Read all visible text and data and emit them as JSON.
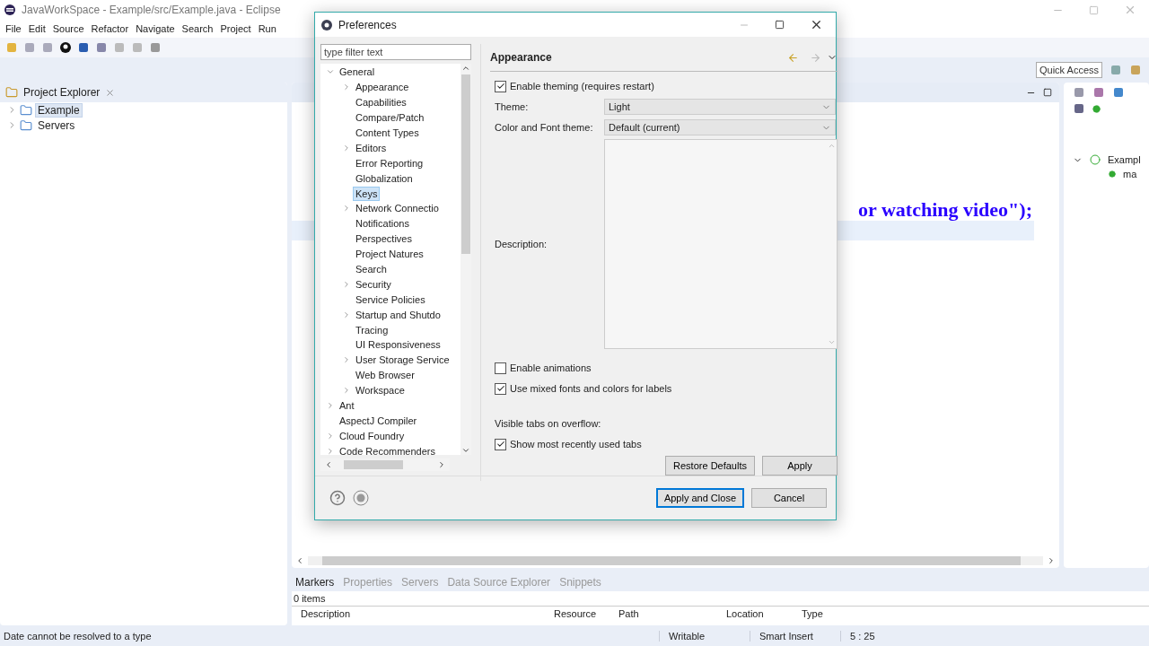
{
  "window": {
    "title": "JavaWorkSpace - Example/src/Example.java - Eclipse"
  },
  "menu": [
    "File",
    "Edit",
    "Source",
    "Refactor",
    "Navigate",
    "Search",
    "Project",
    "Run"
  ],
  "quick_access": {
    "placeholder": "Quick Access"
  },
  "project_explorer": {
    "title": "Project Explorer",
    "items": [
      {
        "label": "Example",
        "selected": true
      },
      {
        "label": "Servers",
        "selected": false
      }
    ]
  },
  "editor": {
    "visible_code": "or watching video\");"
  },
  "outline": {
    "class_name": "Exampl",
    "method_name": "ma"
  },
  "bottom_panel": {
    "tabs": [
      {
        "label": "Markers",
        "selected": true
      },
      {
        "label": "Properties",
        "selected": false
      },
      {
        "label": "Servers",
        "selected": false
      },
      {
        "label": "Data Source Explorer",
        "selected": false
      },
      {
        "label": "Snippets",
        "selected": false
      }
    ],
    "summary": "0 items",
    "columns": [
      "Description",
      "Resource",
      "Path",
      "Location",
      "Type"
    ]
  },
  "status_bar": {
    "message": "Date cannot be resolved to a type",
    "mode": "Writable",
    "insert": "Smart Insert",
    "position": "5 : 25"
  },
  "dialog": {
    "title": "Preferences",
    "filter": {
      "placeholder": "type filter text"
    },
    "tree": [
      {
        "label": "General",
        "kind": "branch",
        "expanded": true,
        "selected": false,
        "children": [
          {
            "label": "Appearance",
            "kind": "branch",
            "expanded": false,
            "selected": false
          },
          {
            "label": "Capabilities",
            "kind": "leaf",
            "selected": false
          },
          {
            "label": "Compare/Patch",
            "kind": "leaf",
            "selected": false
          },
          {
            "label": "Content Types",
            "kind": "leaf",
            "selected": false
          },
          {
            "label": "Editors",
            "kind": "branch",
            "expanded": false,
            "selected": false
          },
          {
            "label": "Error Reporting",
            "kind": "leaf",
            "selected": false
          },
          {
            "label": "Globalization",
            "kind": "leaf",
            "selected": false
          },
          {
            "label": "Keys",
            "kind": "leaf",
            "selected": true
          },
          {
            "label": "Network Connectio",
            "kind": "branch",
            "expanded": false,
            "selected": false
          },
          {
            "label": "Notifications",
            "kind": "leaf",
            "selected": false
          },
          {
            "label": "Perspectives",
            "kind": "leaf",
            "selected": false
          },
          {
            "label": "Project Natures",
            "kind": "leaf",
            "selected": false
          },
          {
            "label": "Search",
            "kind": "leaf",
            "selected": false
          },
          {
            "label": "Security",
            "kind": "branch",
            "expanded": false,
            "selected": false
          },
          {
            "label": "Service Policies",
            "kind": "leaf",
            "selected": false
          },
          {
            "label": "Startup and Shutdo",
            "kind": "branch",
            "expanded": false,
            "selected": false
          },
          {
            "label": "Tracing",
            "kind": "leaf",
            "selected": false
          },
          {
            "label": "UI Responsiveness",
            "kind": "leaf",
            "selected": false
          },
          {
            "label": "User Storage Service",
            "kind": "branch",
            "expanded": false,
            "selected": false
          },
          {
            "label": "Web Browser",
            "kind": "leaf",
            "selected": false
          },
          {
            "label": "Workspace",
            "kind": "branch",
            "expanded": false,
            "selected": false
          }
        ]
      },
      {
        "label": "Ant",
        "kind": "branch",
        "expanded": false,
        "selected": false
      },
      {
        "label": "AspectJ Compiler",
        "kind": "leaf",
        "selected": false
      },
      {
        "label": "Cloud Foundry",
        "kind": "branch",
        "expanded": false,
        "selected": false
      },
      {
        "label": "Code Recommenders",
        "kind": "branch",
        "expanded": false,
        "selected": false
      }
    ],
    "page": {
      "title": "Appearance",
      "settings": [
        {
          "kind": "checkbox",
          "label": "Enable theming (requires restart)",
          "checked": true
        },
        {
          "kind": "select",
          "label": "Theme:",
          "value": "Light"
        },
        {
          "kind": "select",
          "label": "Color and Font theme:",
          "value": "Default (current)"
        },
        {
          "kind": "textarea",
          "label": "Description:"
        },
        {
          "kind": "checkbox",
          "label": "Enable animations",
          "checked": false
        },
        {
          "kind": "checkbox",
          "label": "Use mixed fonts and colors for labels",
          "checked": true
        },
        {
          "kind": "heading",
          "label": "Visible tabs on overflow:"
        },
        {
          "kind": "checkbox",
          "label": "Show most recently used tabs",
          "checked": true
        }
      ],
      "buttons": [
        "Restore Defaults",
        "Apply"
      ]
    },
    "footer_buttons": [
      {
        "label": "Apply and Close",
        "default": true
      },
      {
        "label": "Cancel",
        "default": false
      }
    ]
  }
}
